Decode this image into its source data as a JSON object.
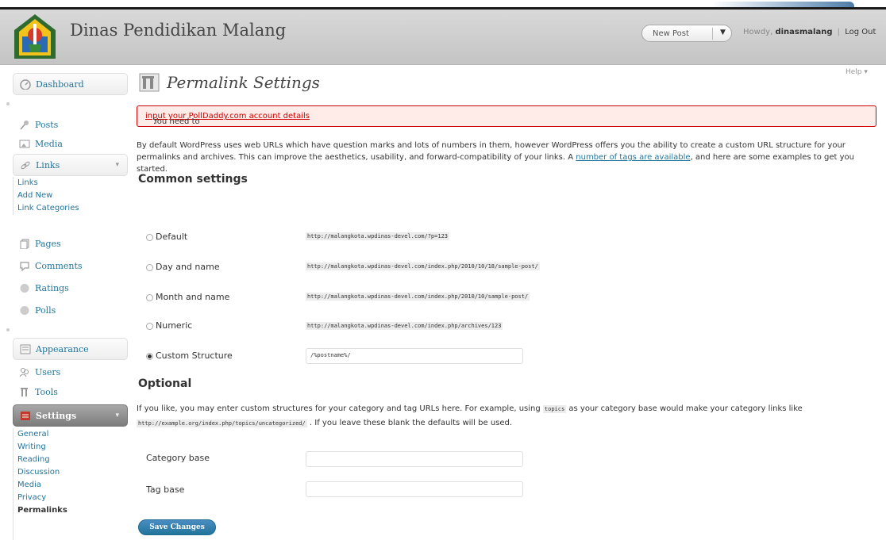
{
  "header": {
    "site_title": "Dinas Pendidikan Malang",
    "new_post_label": "New Post",
    "howdy": "Howdy,",
    "username": "dinasmalang",
    "separator": "|",
    "logout": "Log Out"
  },
  "help_label": "Help",
  "sidebar": {
    "dashboard": "Dashboard",
    "posts": "Posts",
    "media": "Media",
    "links": "Links",
    "links_submenu": [
      "Links",
      "Add New",
      "Link Categories"
    ],
    "pages": "Pages",
    "comments": "Comments",
    "ratings": "Ratings",
    "polls": "Polls",
    "appearance": "Appearance",
    "users": "Users",
    "tools": "Tools",
    "settings": "Settings",
    "settings_submenu": [
      "General",
      "Writing",
      "Reading",
      "Discussion",
      "Media",
      "Privacy",
      "Permalinks"
    ]
  },
  "page_title": "Permalink Settings",
  "notice": {
    "prefix": "You need to ",
    "link": "input your PollDaddy.com account details",
    "suffix": "."
  },
  "intro": {
    "text1": "By default WordPress uses web URLs which have question marks and lots of numbers in them, however WordPress offers you the ability to create a custom URL structure for your permalinks and archives. This can improve the aesthetics, usability, and forward-compatibility of your links. A ",
    "link": "number of tags are available",
    "text2": ", and here are some examples to get you started."
  },
  "common_heading": "Common settings",
  "options": [
    {
      "label": "Default",
      "example": "http://malangkota.wpdinas-devel.com/?p=123",
      "checked": false
    },
    {
      "label": "Day and name",
      "example": "http://malangkota.wpdinas-devel.com/index.php/2010/10/18/sample-post/",
      "checked": false
    },
    {
      "label": "Month and name",
      "example": "http://malangkota.wpdinas-devel.com/index.php/2010/10/sample-post/",
      "checked": false
    },
    {
      "label": "Numeric",
      "example": "http://malangkota.wpdinas-devel.com/index.php/archives/123",
      "checked": false
    },
    {
      "label": "Custom Structure",
      "value": "/%postname%/",
      "checked": true
    }
  ],
  "optional_heading": "Optional",
  "optional_text": {
    "part1": "If you like, you may enter custom structures for your category and tag URLs here. For example, using ",
    "code1": "topics",
    "part2": " as your category base would make your category links like ",
    "code2": "http://example.org/index.php/topics/uncategorized/",
    "part3": " . If you leave these blank the defaults will be used."
  },
  "category_base_label": "Category base",
  "tag_base_label": "Tag base",
  "save_button": "Save Changes"
}
